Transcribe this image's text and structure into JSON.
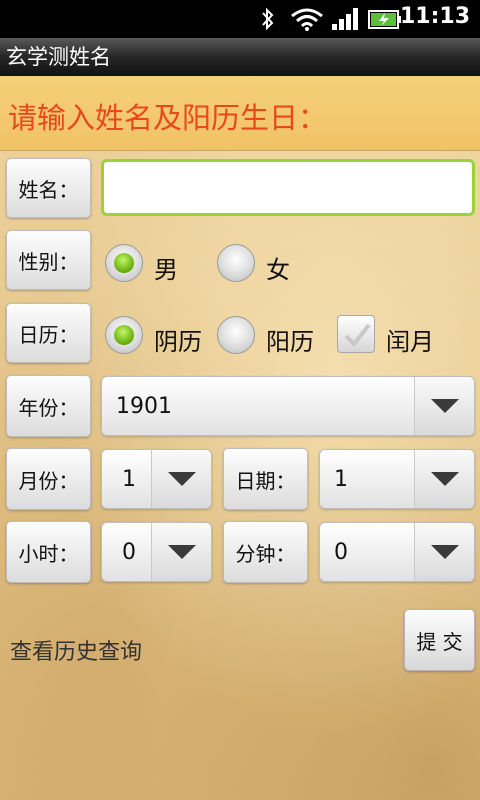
{
  "status_bar": {
    "time": "11:13",
    "icons": [
      "bluetooth-icon",
      "wifi-icon",
      "signal-icon",
      "battery-charging-icon"
    ]
  },
  "app": {
    "title": "玄学测姓名"
  },
  "banner": {
    "text": "请输入姓名及阳历生日："
  },
  "form": {
    "name_label": "姓名：",
    "name_value": "",
    "gender_label": "性别：",
    "gender_options": [
      {
        "label": "男",
        "selected": true
      },
      {
        "label": "女",
        "selected": false
      }
    ],
    "calendar_label": "日历：",
    "calendar_options": [
      {
        "label": "阴历",
        "selected": true
      },
      {
        "label": "阳历",
        "selected": false
      }
    ],
    "leap_month_label": "闰月",
    "leap_month_checked": false,
    "year_label": "年份：",
    "year_value": "1901",
    "month_label": "月份：",
    "month_value": "1",
    "day_label": "日期：",
    "day_value": "1",
    "hour_label": "小时：",
    "hour_value": "0",
    "minute_label": "分钟：",
    "minute_value": "0"
  },
  "footer": {
    "history_link": "查看历史查询",
    "submit_label": "提 交"
  },
  "colors": {
    "banner_text": "#e8481e",
    "input_focus_border": "#9bd23a",
    "radio_selected": "#6fb814"
  }
}
